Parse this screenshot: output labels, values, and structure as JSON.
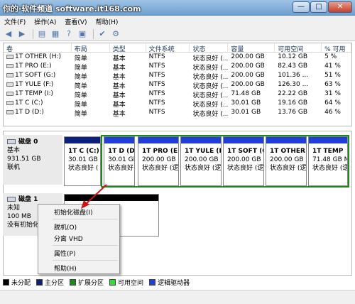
{
  "window": {
    "watermark": "你的·软件频道 software.it168.com",
    "min": "—",
    "max": "□",
    "close": "✕"
  },
  "menu": [
    "文件(F)",
    "操作(A)",
    "查看(V)",
    "帮助(H)"
  ],
  "columns": [
    "卷",
    "布局",
    "类型",
    "文件系统",
    "状态",
    "容量",
    "可用空间",
    "% 可用"
  ],
  "volumes": [
    [
      "1T OTHER (H:)",
      "简单",
      "基本",
      "NTFS",
      "状态良好 (...",
      "200.00 GB",
      "10.12 GB",
      "5 %"
    ],
    [
      "1T PRO (E:)",
      "简单",
      "基本",
      "NTFS",
      "状态良好 (...",
      "200.00 GB",
      "82.43 GB",
      "41 %"
    ],
    [
      "1T SOFT (G:)",
      "简单",
      "基本",
      "NTFS",
      "状态良好 (...",
      "200.00 GB",
      "101.36 ...",
      "51 %"
    ],
    [
      "1T YULE (F:)",
      "简单",
      "基本",
      "NTFS",
      "状态良好 (...",
      "200.00 GB",
      "126.30 ...",
      "63 %"
    ],
    [
      "1T TEMP (I:)",
      "简单",
      "基本",
      "NTFS",
      "状态良好 (...",
      "71.48 GB",
      "22.22 GB",
      "31 %"
    ],
    [
      "1T C (C:)",
      "简单",
      "基本",
      "NTFS",
      "状态良好 (...",
      "30.01 GB",
      "19.16 GB",
      "64 %"
    ],
    [
      "1T D (D:)",
      "简单",
      "基本",
      "NTFS",
      "状态良好 (...",
      "30.01 GB",
      "13.76 GB",
      "46 %"
    ]
  ],
  "disk0": {
    "name": "磁盘 0",
    "type": "基本",
    "size": "931.51 GB",
    "status": "联机"
  },
  "partitions": [
    {
      "name": "1T C (C:)",
      "size": "30.01 GB",
      "status": "状态良好 (",
      "kind": "primary"
    },
    {
      "name": "1T D (D",
      "size": "30.01 GB",
      "status": "状态良好",
      "kind": "logical"
    },
    {
      "name": "1T PRO (E:",
      "size": "200.00 GB N",
      "status": "状态良好 (逻",
      "kind": "logical"
    },
    {
      "name": "1T YULE (F",
      "size": "200.00 GB N",
      "status": "状态良好 (逻",
      "kind": "logical"
    },
    {
      "name": "1T SOFT (G",
      "size": "200.00 GB N",
      "status": "状态良好 (逻",
      "kind": "logical"
    },
    {
      "name": "1T OTHER",
      "size": "200.00 GB N",
      "status": "状态良好 (逻",
      "kind": "logical"
    },
    {
      "name": "1T TEMP",
      "size": "71.48 GB N",
      "status": "状态良好 (逻",
      "kind": "logical"
    }
  ],
  "disk1": {
    "name": "磁盘 1",
    "status": "未知",
    "size": "100 MB",
    "init": "没有初始化"
  },
  "context_menu": {
    "init": "初始化磁盘(I)",
    "offline": "脱机(O)",
    "detach": "分离 VHD",
    "props": "属性(P)",
    "help": "帮助(H)"
  },
  "legend": [
    {
      "label": "未分配",
      "color": "#000000"
    },
    {
      "label": "主分区",
      "color": "#0c1f7c"
    },
    {
      "label": "扩展分区",
      "color": "#1c8a1c"
    },
    {
      "label": "可用空间",
      "color": "#33dd33"
    },
    {
      "label": "逻辑驱动器",
      "color": "#1f3fd8"
    }
  ],
  "colors": {
    "primary": "#0c1f7c",
    "logical": "#1f3fd8",
    "extended": "#1c8a1c",
    "arrow": "#cc1111"
  },
  "icons": [
    "back-icon",
    "forward-icon",
    "list-icon",
    "properties-icon",
    "help-icon",
    "grid-icon",
    "check-icon",
    "disk-settings-icon"
  ]
}
